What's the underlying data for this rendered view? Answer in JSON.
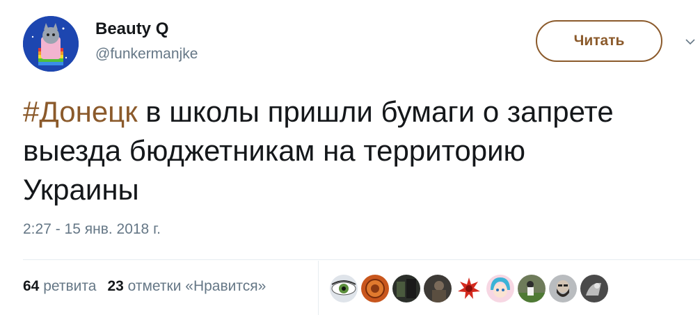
{
  "user": {
    "display_name": "Beauty Q",
    "handle": "@funkermanjke",
    "avatar_icon": "nyan-cat-avatar-icon"
  },
  "actions": {
    "follow_label": "Читать",
    "more_icon": "chevron-down-icon"
  },
  "tweet": {
    "hashtag": "#Донецк",
    "text": " в школы пришли бумаги о запрете выезда бюджетникам на территорию Украины",
    "timestamp": "2:27 - 15 янв. 2018 г."
  },
  "stats": {
    "retweets_count": "64",
    "retweets_label": "ретвита",
    "likes_count": "23",
    "likes_label": "отметки «Нравится»"
  },
  "likers": [
    {
      "icon": "eye-avatar-icon"
    },
    {
      "icon": "orange-emblem-avatar-icon"
    },
    {
      "icon": "dark-photo-avatar-icon"
    },
    {
      "icon": "soldier-avatar-icon"
    },
    {
      "icon": "red-spiky-avatar-icon"
    },
    {
      "icon": "anime-girl-avatar-icon"
    },
    {
      "icon": "football-avatar-icon"
    },
    {
      "icon": "bearded-man-avatar-icon"
    },
    {
      "icon": "bw-photo-avatar-icon"
    }
  ],
  "colors": {
    "accent": "#8b5a2b",
    "text": "#14171a",
    "secondary": "#657786",
    "divider": "#e6ecf0"
  }
}
